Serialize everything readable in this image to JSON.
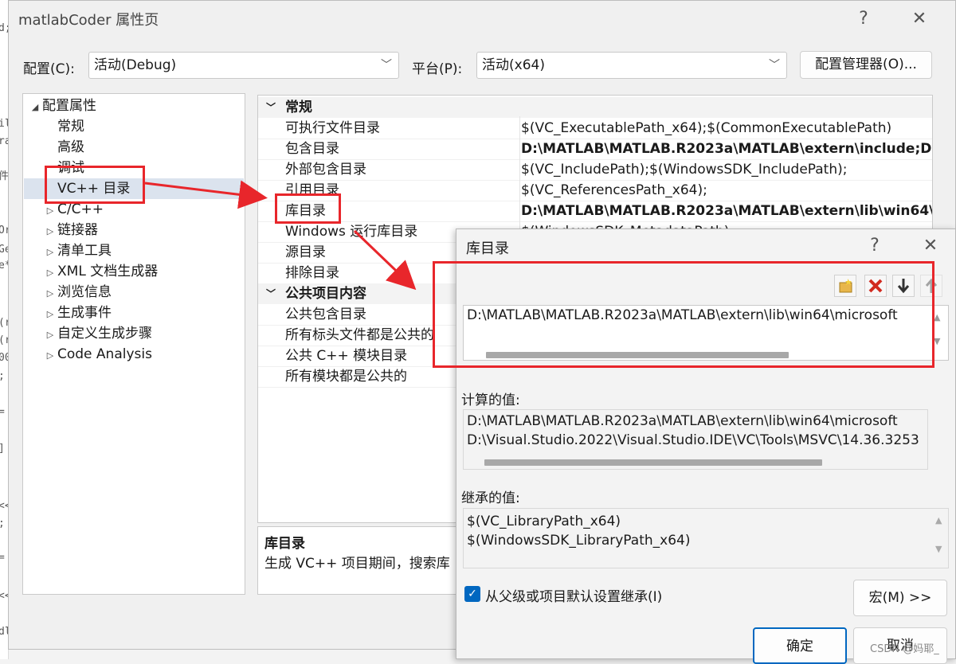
{
  "window": {
    "title": "matlabCoder 属性页",
    "help_glyph": "?",
    "close_glyph": "✕"
  },
  "toolbar": {
    "config_label": "配置(C):",
    "config_value": "活动(Debug)",
    "platform_label": "平台(P):",
    "platform_value": "活动(x64)",
    "config_manager_label": "配置管理器(O)..."
  },
  "tree": {
    "root": "配置属性",
    "items": [
      "常规",
      "高级",
      "调试",
      "VC++ 目录",
      "C/C++",
      "链接器",
      "清单工具",
      "XML 文档生成器",
      "浏览信息",
      "生成事件",
      "自定义生成步骤",
      "Code Analysis"
    ],
    "selected": "VC++ 目录"
  },
  "grid": {
    "category1": "常规",
    "rows1": [
      {
        "name": "可执行文件目录",
        "value": "$(VC_ExecutablePath_x64);$(CommonExecutablePath)",
        "bold": false
      },
      {
        "name": "包含目录",
        "value": "D:\\MATLAB\\MATLAB.R2023a\\MATLAB\\extern\\include;D:",
        "bold": true
      },
      {
        "name": "外部包含目录",
        "value": "$(VC_IncludePath);$(WindowsSDK_IncludePath);",
        "bold": false
      },
      {
        "name": "引用目录",
        "value": "$(VC_ReferencesPath_x64);",
        "bold": false
      },
      {
        "name": "库目录",
        "value": "D:\\MATLAB\\MATLAB.R2023a\\MATLAB\\extern\\lib\\win64\\",
        "bold": true
      },
      {
        "name": "Windows 运行库目录",
        "value": "$(WindowsSDK_MetadataPath);",
        "bold": false
      },
      {
        "name": "源目录",
        "value": "",
        "bold": false
      },
      {
        "name": "排除目录",
        "value": "",
        "bold": false
      }
    ],
    "category2": "公共项目内容",
    "rows2": [
      {
        "name": "公共包含目录"
      },
      {
        "name": "所有标头文件都是公共的"
      },
      {
        "name": "公共 C++ 模块目录"
      },
      {
        "name": "所有模块都是公共的"
      }
    ]
  },
  "description": {
    "title": "库目录",
    "text": "生成 VC++ 项目期间，搜索库"
  },
  "dialog": {
    "title": "库目录",
    "help_glyph": "?",
    "close_glyph": "✕",
    "edit_value": "D:\\MATLAB\\MATLAB.R2023a\\MATLAB\\extern\\lib\\win64\\microsoft",
    "evaluated_label": "计算的值:",
    "evaluated_lines": [
      "D:\\MATLAB\\MATLAB.R2023a\\MATLAB\\extern\\lib\\win64\\microsoft",
      "D:\\Visual.Studio.2022\\Visual.Studio.IDE\\VC\\Tools\\MSVC\\14.36.3253"
    ],
    "inherited_label": "继承的值:",
    "inherited_lines": [
      "$(VC_LibraryPath_x64)",
      "$(WindowsSDK_LibraryPath_x64)"
    ],
    "inherit_checkbox_label": "从父级或项目默认设置继承(I)",
    "inherit_checked": true,
    "macro_button": "宏(M) >>",
    "ok_button": "确定",
    "cancel_button": "取消"
  },
  "watermark": "CSDN @妈耶_",
  "code_strip": [
    "d;",
    "il",
    "ra",
    "件",
    "Or",
    "Ge",
    "e*",
    "(r",
    "(r",
    "00",
    ";",
    "=",
    "]",
    "<<",
    ";",
    "=",
    "<<",
    "dl"
  ],
  "colors": {
    "accent": "#0067c0",
    "annotation_red": "#e8262b",
    "selection": "#cce4f7"
  }
}
